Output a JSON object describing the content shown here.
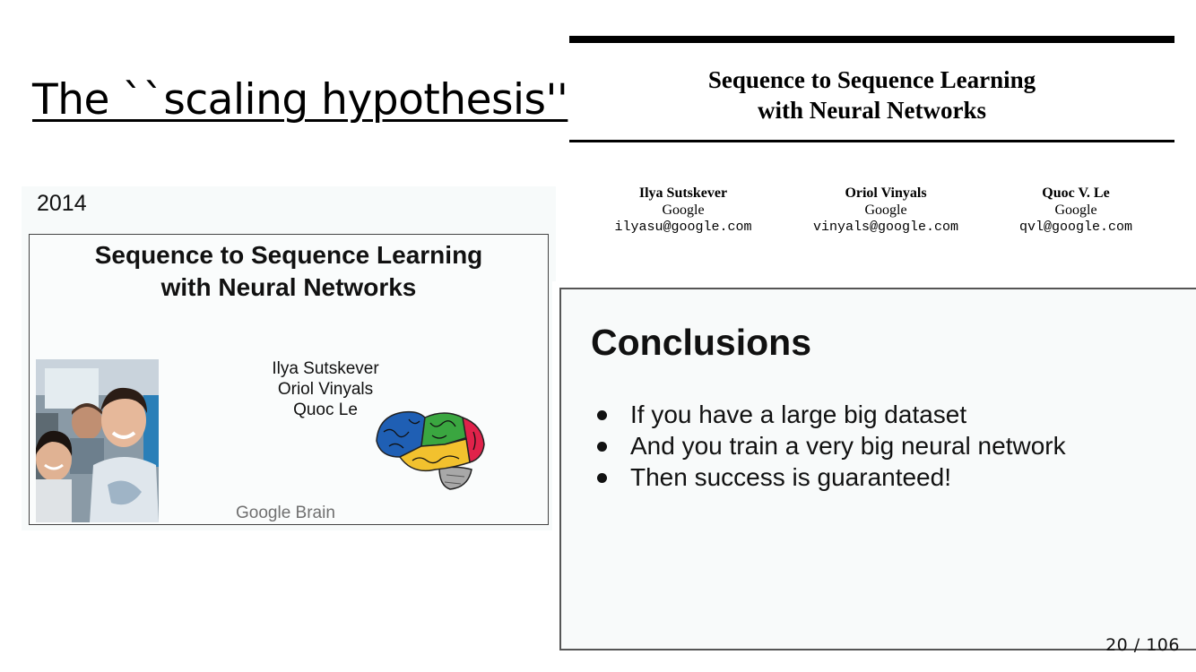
{
  "slide": {
    "title": "The ``scaling hypothesis''",
    "page_counter": "20 / 106"
  },
  "left_panel": {
    "year": "2014",
    "embedded_slide": {
      "title_line1": "Sequence to Sequence Learning",
      "title_line2": "with Neural Networks",
      "authors": [
        "Ilya Sutskever",
        "Oriol Vinyals",
        "Quoc Le"
      ],
      "affiliation": "Google Brain"
    }
  },
  "paper_header": {
    "title_line1": "Sequence to Sequence Learning",
    "title_line2": "with Neural Networks",
    "authors": [
      {
        "name": "Ilya Sutskever",
        "org": "Google",
        "email": "ilyasu@google.com"
      },
      {
        "name": "Oriol Vinyals",
        "org": "Google",
        "email": "vinyals@google.com"
      },
      {
        "name": "Quoc V. Le",
        "org": "Google",
        "email": "qvl@google.com"
      }
    ]
  },
  "conclusions": {
    "title": "Conclusions",
    "bullets": [
      "If you have a large big dataset",
      "And you train a very big neural network",
      "Then success is guaranteed!"
    ]
  },
  "icons": {
    "photo": "authors-photo",
    "brain": "brain-icon"
  },
  "colors": {
    "brain_blue": "#1f5fb4",
    "brain_green": "#3aa640",
    "brain_yellow": "#f2c12e",
    "brain_red": "#e0224a",
    "brain_stem": "#a8a8a8"
  }
}
